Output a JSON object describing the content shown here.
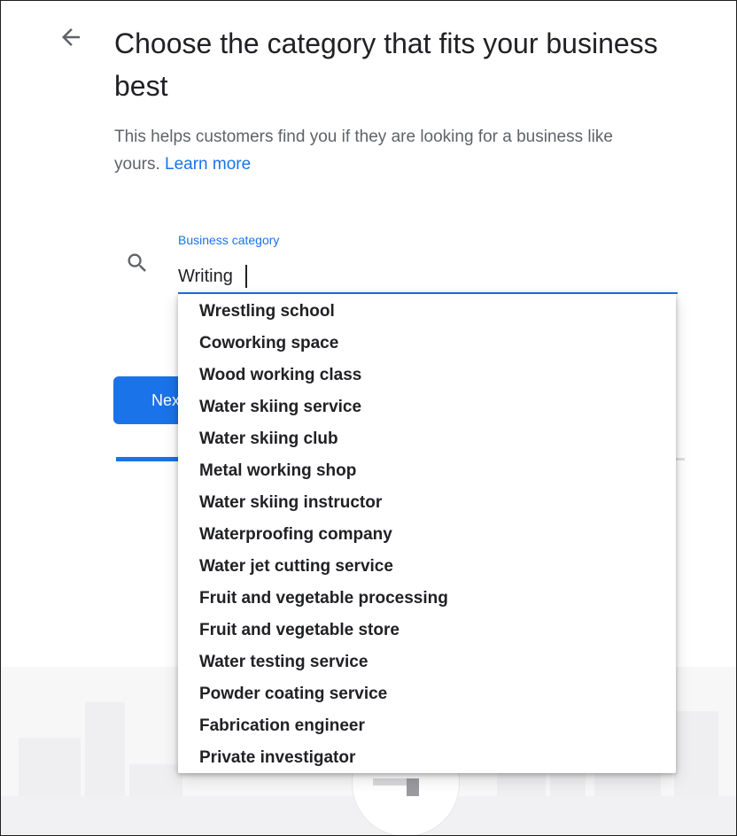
{
  "header": {
    "back_icon": "arrow-left-icon",
    "title": "Choose the category that fits your business best",
    "subtitle": "This helps customers find you if they are looking for a business like yours.",
    "learn_more_label": "Learn more"
  },
  "search": {
    "icon": "search-icon",
    "label": "Business category",
    "value": "Writing"
  },
  "next_button": {
    "label": "Next"
  },
  "progress": {
    "value": 0.12
  },
  "suggestions": [
    "Wrestling school",
    "Coworking space",
    "Wood working class",
    "Water skiing service",
    "Water skiing club",
    "Metal working shop",
    "Water skiing instructor",
    "Waterproofing company",
    "Water jet cutting service",
    "Fruit and vegetable processing",
    "Fruit and vegetable store",
    "Water testing service",
    "Powder coating service",
    "Fabrication engineer",
    "Private investigator"
  ],
  "colors": {
    "accent": "#1a73e8",
    "text_primary": "#202124",
    "text_secondary": "#5f6368"
  }
}
